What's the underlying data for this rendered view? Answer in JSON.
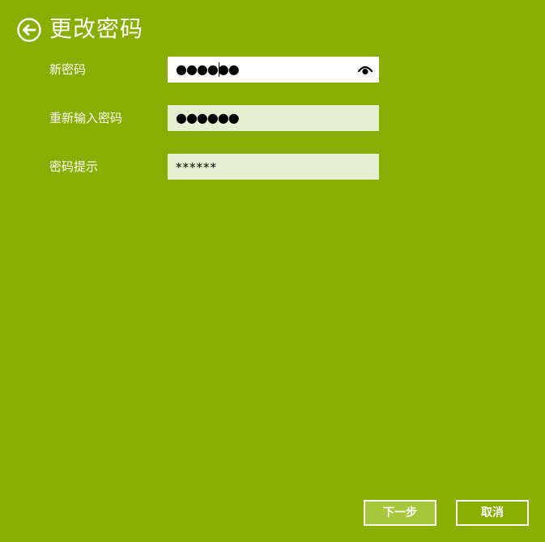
{
  "header": {
    "title": "更改密码",
    "back_icon": "arrow-left-circle-icon"
  },
  "form": {
    "new_password": {
      "label": "新密码",
      "value": "●●●●●●",
      "reveal_icon": "eye-icon"
    },
    "confirm_password": {
      "label": "重新输入密码",
      "value": "●●●●●●"
    },
    "password_hint": {
      "label": "密码提示",
      "value": "******"
    }
  },
  "buttons": {
    "next_label": "下一步",
    "cancel_label": "取消"
  },
  "colors": {
    "background": "#8aae00",
    "active_field": "#ffffff",
    "inactive_field": "#e6eed0",
    "next_button_fill": "#a8c63a",
    "text": "#ffffff"
  }
}
